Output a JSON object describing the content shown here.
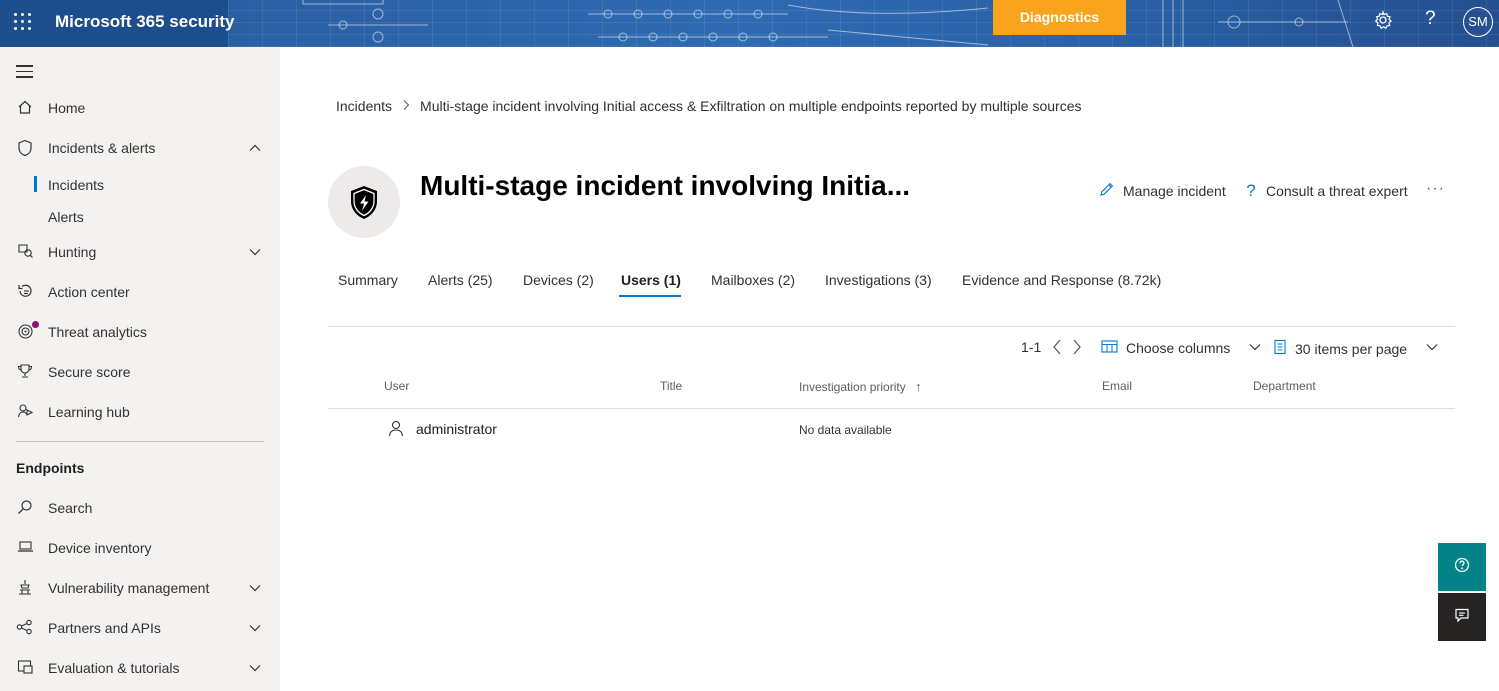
{
  "header": {
    "app_title": "Microsoft 365 security",
    "diagnostics_label": "Diagnostics",
    "avatar_initials": "SM",
    "icons": [
      "waffle-icon",
      "settings-icon",
      "help-icon"
    ]
  },
  "sidebar": {
    "items": [
      {
        "label": "Home",
        "icon": "home-icon"
      },
      {
        "label": "Incidents & alerts",
        "icon": "shield-icon",
        "expanded": true
      },
      {
        "label": "Hunting",
        "icon": "hunting-icon",
        "expanded": false
      },
      {
        "label": "Action center",
        "icon": "action-center-icon"
      },
      {
        "label": "Threat analytics",
        "icon": "threat-analytics-icon",
        "notification_dot": true
      },
      {
        "label": "Secure score",
        "icon": "trophy-icon"
      },
      {
        "label": "Learning hub",
        "icon": "learning-hub-icon"
      }
    ],
    "sub_items": [
      {
        "label": "Incidents",
        "selected": true
      },
      {
        "label": "Alerts",
        "selected": false
      }
    ],
    "section_heading": "Endpoints",
    "endpoint_items": [
      {
        "label": "Search",
        "icon": "search-icon"
      },
      {
        "label": "Device inventory",
        "icon": "laptop-icon"
      },
      {
        "label": "Vulnerability management",
        "icon": "vulnerability-icon",
        "expanded": false
      },
      {
        "label": "Partners and APIs",
        "icon": "partners-icon",
        "expanded": false
      },
      {
        "label": "Evaluation & tutorials",
        "icon": "evaluation-icon",
        "expanded": false
      }
    ]
  },
  "breadcrumb": {
    "root": "Incidents",
    "current": "Multi-stage incident involving Initial access & Exfiltration on multiple endpoints reported by multiple sources"
  },
  "incident": {
    "title": "Multi-stage incident involving Initia...",
    "manage_label": "Manage incident",
    "consult_label": "Consult a threat expert",
    "more_label": "···"
  },
  "tabs": [
    {
      "label": "Summary",
      "active": false
    },
    {
      "label": "Alerts (25)",
      "active": false
    },
    {
      "label": "Devices (2)",
      "active": false
    },
    {
      "label": "Users (1)",
      "active": true
    },
    {
      "label": "Mailboxes (2)",
      "active": false
    },
    {
      "label": "Investigations (3)",
      "active": false
    },
    {
      "label": "Evidence and Response (8.72k)",
      "active": false
    }
  ],
  "toolbar": {
    "range": "1-1",
    "choose_columns": "Choose columns",
    "items_per_page": "30 items per page"
  },
  "table": {
    "columns": [
      "User",
      "Title",
      "Investigation priority",
      "Email",
      "Department"
    ],
    "sort_indicator": "↑",
    "rows": [
      {
        "user": "administrator",
        "title": "",
        "investigation_priority": "No data available",
        "email": "",
        "department": ""
      }
    ]
  },
  "colors": {
    "accent": "#0078d4",
    "header_bg": "#1c4d8c",
    "diagnostics_bg": "#f8a51d",
    "help_fab": "#038387",
    "feedback_fab": "#252423"
  }
}
